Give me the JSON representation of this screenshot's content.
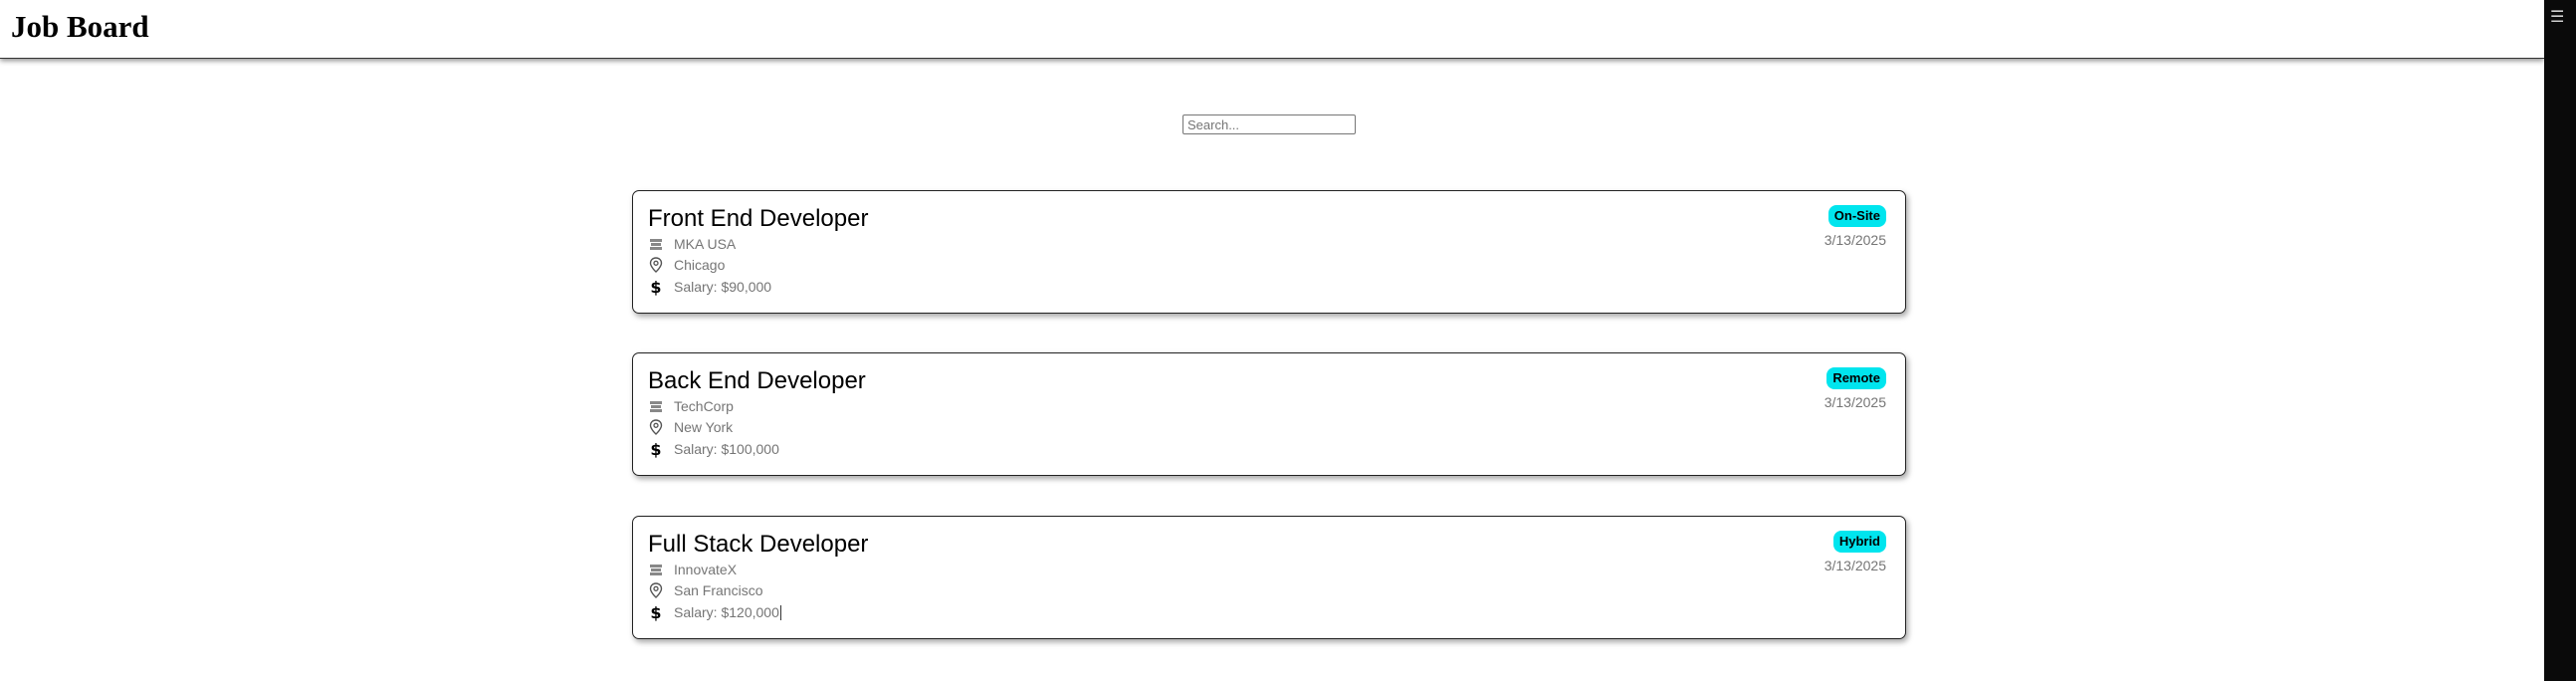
{
  "header": {
    "title": "Job Board"
  },
  "menu": {
    "icon": "menu-icon"
  },
  "search": {
    "placeholder": "Search...",
    "value": ""
  },
  "accent_color": "#00e5ee",
  "jobs": [
    {
      "title": "Front End Developer",
      "company": "MKA USA",
      "location": "Chicago",
      "salary": "Salary: $90,000",
      "badge": "On-Site",
      "date": "3/13/2025"
    },
    {
      "title": "Back End Developer",
      "company": "TechCorp",
      "location": "New York",
      "salary": "Salary: $100,000",
      "badge": "Remote",
      "date": "3/13/2025"
    },
    {
      "title": "Full Stack Developer",
      "company": "InnovateX",
      "location": "San Francisco",
      "salary": "Salary: $120,000",
      "badge": "Hybrid",
      "date": "3/13/2025"
    }
  ]
}
